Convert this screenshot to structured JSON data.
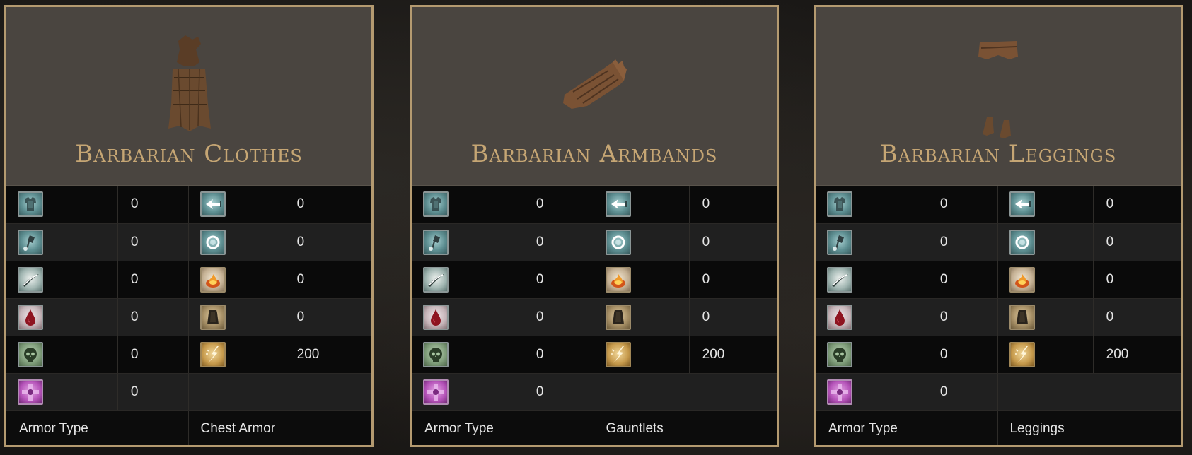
{
  "cards": [
    {
      "title": "Barbarian Clothes",
      "item_image": "barbarian-clothes-image",
      "stats": {
        "physical": "0",
        "strike": "0",
        "slash": "0",
        "blood": "0",
        "poison": "0",
        "arcane": "0",
        "thrust": "0",
        "magic": "0",
        "fire": "0",
        "frost": "0",
        "lightning": "200"
      },
      "armor_type_label": "Armor Type",
      "armor_type_value": "Chest Armor"
    },
    {
      "title": "Barbarian Armbands",
      "item_image": "barbarian-armbands-image",
      "stats": {
        "physical": "0",
        "strike": "0",
        "slash": "0",
        "blood": "0",
        "poison": "0",
        "arcane": "0",
        "thrust": "0",
        "magic": "0",
        "fire": "0",
        "frost": "0",
        "lightning": "200"
      },
      "armor_type_label": "Armor Type",
      "armor_type_value": "Gauntlets"
    },
    {
      "title": "Barbarian Leggings",
      "item_image": "barbarian-leggings-image",
      "stats": {
        "physical": "0",
        "strike": "0",
        "slash": "0",
        "blood": "0",
        "poison": "0",
        "arcane": "0",
        "thrust": "0",
        "magic": "0",
        "fire": "0",
        "frost": "0",
        "lightning": "200"
      },
      "armor_type_label": "Armor Type",
      "armor_type_value": "Leggings"
    }
  ],
  "icons": {
    "left_column": [
      "physical-armor-icon",
      "strike-hammer-icon",
      "slash-blade-icon",
      "blood-drop-icon",
      "poison-skull-icon",
      "arcane-cross-icon"
    ],
    "right_column": [
      "thrust-arrow-icon",
      "magic-ring-icon",
      "fire-icon",
      "frost-bell-icon",
      "lightning-icon"
    ]
  },
  "colors": {
    "frame_gold": "#b49a70",
    "title_gold": "#c6a674",
    "header_bg": "#4a4540",
    "value_text": "#e6e6e6"
  }
}
